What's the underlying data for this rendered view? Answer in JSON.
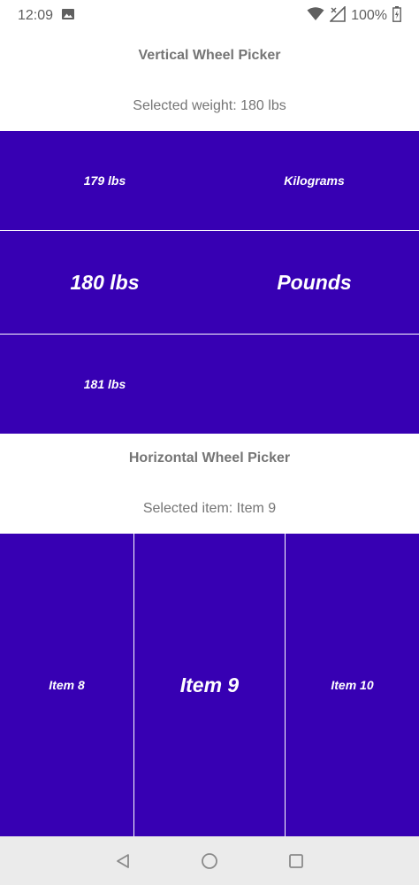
{
  "status_bar": {
    "time": "12:09",
    "battery": "100%",
    "icons": [
      "image-icon",
      "wifi-icon",
      "no-signal-icon",
      "battery-icon"
    ]
  },
  "vertical_picker": {
    "title": "Vertical Wheel Picker",
    "selected_text": "Selected weight: 180 lbs",
    "weights": [
      "179 lbs",
      "180 lbs",
      "181 lbs"
    ],
    "units": [
      "Kilograms",
      "Pounds"
    ],
    "background_color": "#3700b3"
  },
  "horizontal_picker": {
    "title": "Horizontal Wheel Picker",
    "selected_text": "Selected item: Item 9",
    "items": [
      "Item 8",
      "Item 9",
      "Item 10"
    ],
    "background_color": "#3700b3"
  },
  "nav_bar": {
    "icons": [
      "back-icon",
      "home-icon",
      "recents-icon"
    ]
  }
}
